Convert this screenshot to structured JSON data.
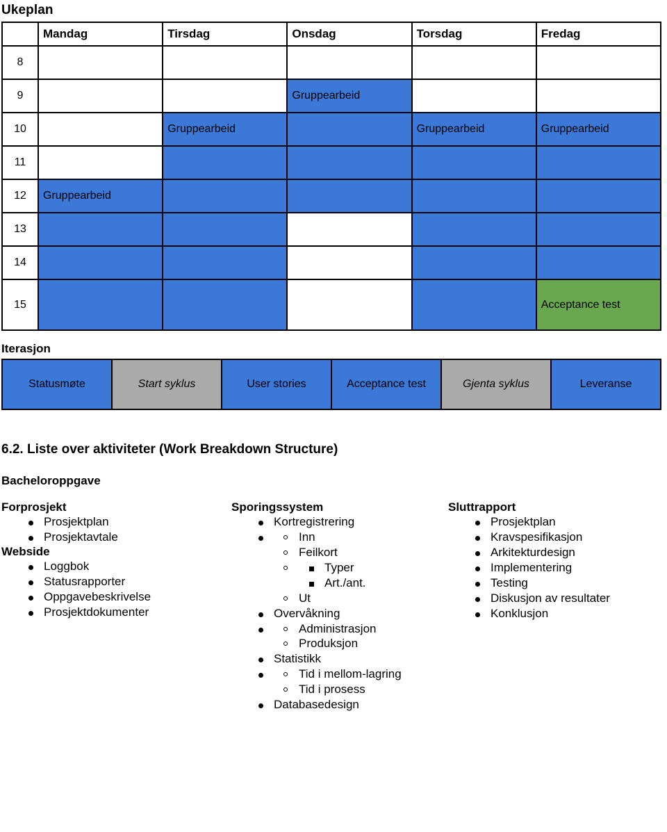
{
  "document": {
    "week_plan_title": "Ukeplan",
    "iteration_title": "Iterasjon",
    "section_title": "6.2. Liste over aktiviteter (Work Breakdown Structure)",
    "project_name": "Bacheloroppgave"
  },
  "colors": {
    "busy": "#3c78d8",
    "test": "#6aa84f",
    "cycle": "#aaaaaa",
    "empty": "#ffffff",
    "border": "#000000"
  },
  "week_table": {
    "corner_label": "",
    "day_headers": [
      "Mandag",
      "Tirsdag",
      "Onsdag",
      "Torsdag",
      "Fredag"
    ],
    "hours": [
      "8",
      "9",
      "10",
      "11",
      "12",
      "13",
      "14",
      "15"
    ],
    "labels": {
      "gruppearbeid": "Gruppearbeid",
      "acceptance_test": "Acceptance test"
    },
    "rows": [
      {
        "hour": "8",
        "cells": [
          {
            "state": "empty",
            "text": ""
          },
          {
            "state": "empty",
            "text": ""
          },
          {
            "state": "empty",
            "text": ""
          },
          {
            "state": "empty",
            "text": ""
          },
          {
            "state": "empty",
            "text": ""
          }
        ]
      },
      {
        "hour": "9",
        "cells": [
          {
            "state": "empty",
            "text": ""
          },
          {
            "state": "empty",
            "text": ""
          },
          {
            "state": "busy",
            "text": "Gruppearbeid"
          },
          {
            "state": "empty",
            "text": ""
          },
          {
            "state": "empty",
            "text": ""
          }
        ]
      },
      {
        "hour": "10",
        "cells": [
          {
            "state": "empty",
            "text": ""
          },
          {
            "state": "busy",
            "text": "Gruppearbeid"
          },
          {
            "state": "busy",
            "text": ""
          },
          {
            "state": "busy",
            "text": "Gruppearbeid"
          },
          {
            "state": "busy",
            "text": "Gruppearbeid"
          }
        ]
      },
      {
        "hour": "11",
        "cells": [
          {
            "state": "empty",
            "text": ""
          },
          {
            "state": "busy",
            "text": ""
          },
          {
            "state": "busy",
            "text": ""
          },
          {
            "state": "busy",
            "text": ""
          },
          {
            "state": "busy",
            "text": ""
          }
        ]
      },
      {
        "hour": "12",
        "cells": [
          {
            "state": "busy",
            "text": "Gruppearbeid"
          },
          {
            "state": "busy",
            "text": ""
          },
          {
            "state": "busy",
            "text": ""
          },
          {
            "state": "busy",
            "text": ""
          },
          {
            "state": "busy",
            "text": ""
          }
        ]
      },
      {
        "hour": "13",
        "cells": [
          {
            "state": "busy",
            "text": ""
          },
          {
            "state": "busy",
            "text": ""
          },
          {
            "state": "empty",
            "text": ""
          },
          {
            "state": "busy",
            "text": ""
          },
          {
            "state": "busy",
            "text": ""
          }
        ]
      },
      {
        "hour": "14",
        "cells": [
          {
            "state": "busy",
            "text": ""
          },
          {
            "state": "busy",
            "text": ""
          },
          {
            "state": "empty",
            "text": ""
          },
          {
            "state": "busy",
            "text": ""
          },
          {
            "state": "busy",
            "text": ""
          }
        ]
      },
      {
        "hour": "15",
        "cells": [
          {
            "state": "busy",
            "text": ""
          },
          {
            "state": "busy",
            "text": ""
          },
          {
            "state": "empty",
            "text": ""
          },
          {
            "state": "busy",
            "text": ""
          },
          {
            "state": "test",
            "text": "Acceptance test"
          }
        ]
      }
    ]
  },
  "iteration_table": {
    "cells": [
      {
        "label": "Statusmøte",
        "state": "blue"
      },
      {
        "label": "Start syklus",
        "state": "gray"
      },
      {
        "label": "User stories",
        "state": "blue"
      },
      {
        "label": "Acceptance test",
        "state": "blue"
      },
      {
        "label": "Gjenta syklus",
        "state": "gray"
      },
      {
        "label": "Leveranse",
        "state": "blue"
      }
    ]
  },
  "wbs": {
    "columns": [
      {
        "groups": [
          {
            "heading": "Forprosjekt",
            "items": [
              {
                "label": "Prosjektplan"
              },
              {
                "label": "Prosjektavtale"
              }
            ]
          },
          {
            "heading": "Webside",
            "items": [
              {
                "label": "Loggbok"
              },
              {
                "label": "Statusrapporter"
              },
              {
                "label": "Oppgavebeskrivelse"
              },
              {
                "label": "Prosjektdokumenter"
              }
            ]
          }
        ]
      },
      {
        "groups": [
          {
            "heading": "Sporingssystem",
            "items": [
              {
                "label": "Kortregistrering",
                "children": [
                  {
                    "label": "Inn"
                  },
                  {
                    "label": "Feilkort",
                    "children": [
                      {
                        "label": "Typer"
                      },
                      {
                        "label": "Art./ant."
                      }
                    ]
                  },
                  {
                    "label": "Ut"
                  }
                ]
              },
              {
                "label": "Overvåkning",
                "children": [
                  {
                    "label": "Administrasjon"
                  },
                  {
                    "label": "Produksjon"
                  }
                ]
              },
              {
                "label": "Statistikk",
                "children": [
                  {
                    "label": "Tid i mellom-lagring"
                  },
                  {
                    "label": "Tid i prosess"
                  }
                ]
              },
              {
                "label": "Databasedesign"
              }
            ]
          }
        ]
      },
      {
        "groups": [
          {
            "heading": "Sluttrapport",
            "items": [
              {
                "label": "Prosjektplan"
              },
              {
                "label": "Kravspesifikasjon"
              },
              {
                "label": "Arkitekturdesign"
              },
              {
                "label": "Implementering"
              },
              {
                "label": "Testing"
              },
              {
                "label": "Diskusjon av resultater"
              },
              {
                "label": "Konklusjon"
              }
            ]
          }
        ]
      }
    ]
  }
}
